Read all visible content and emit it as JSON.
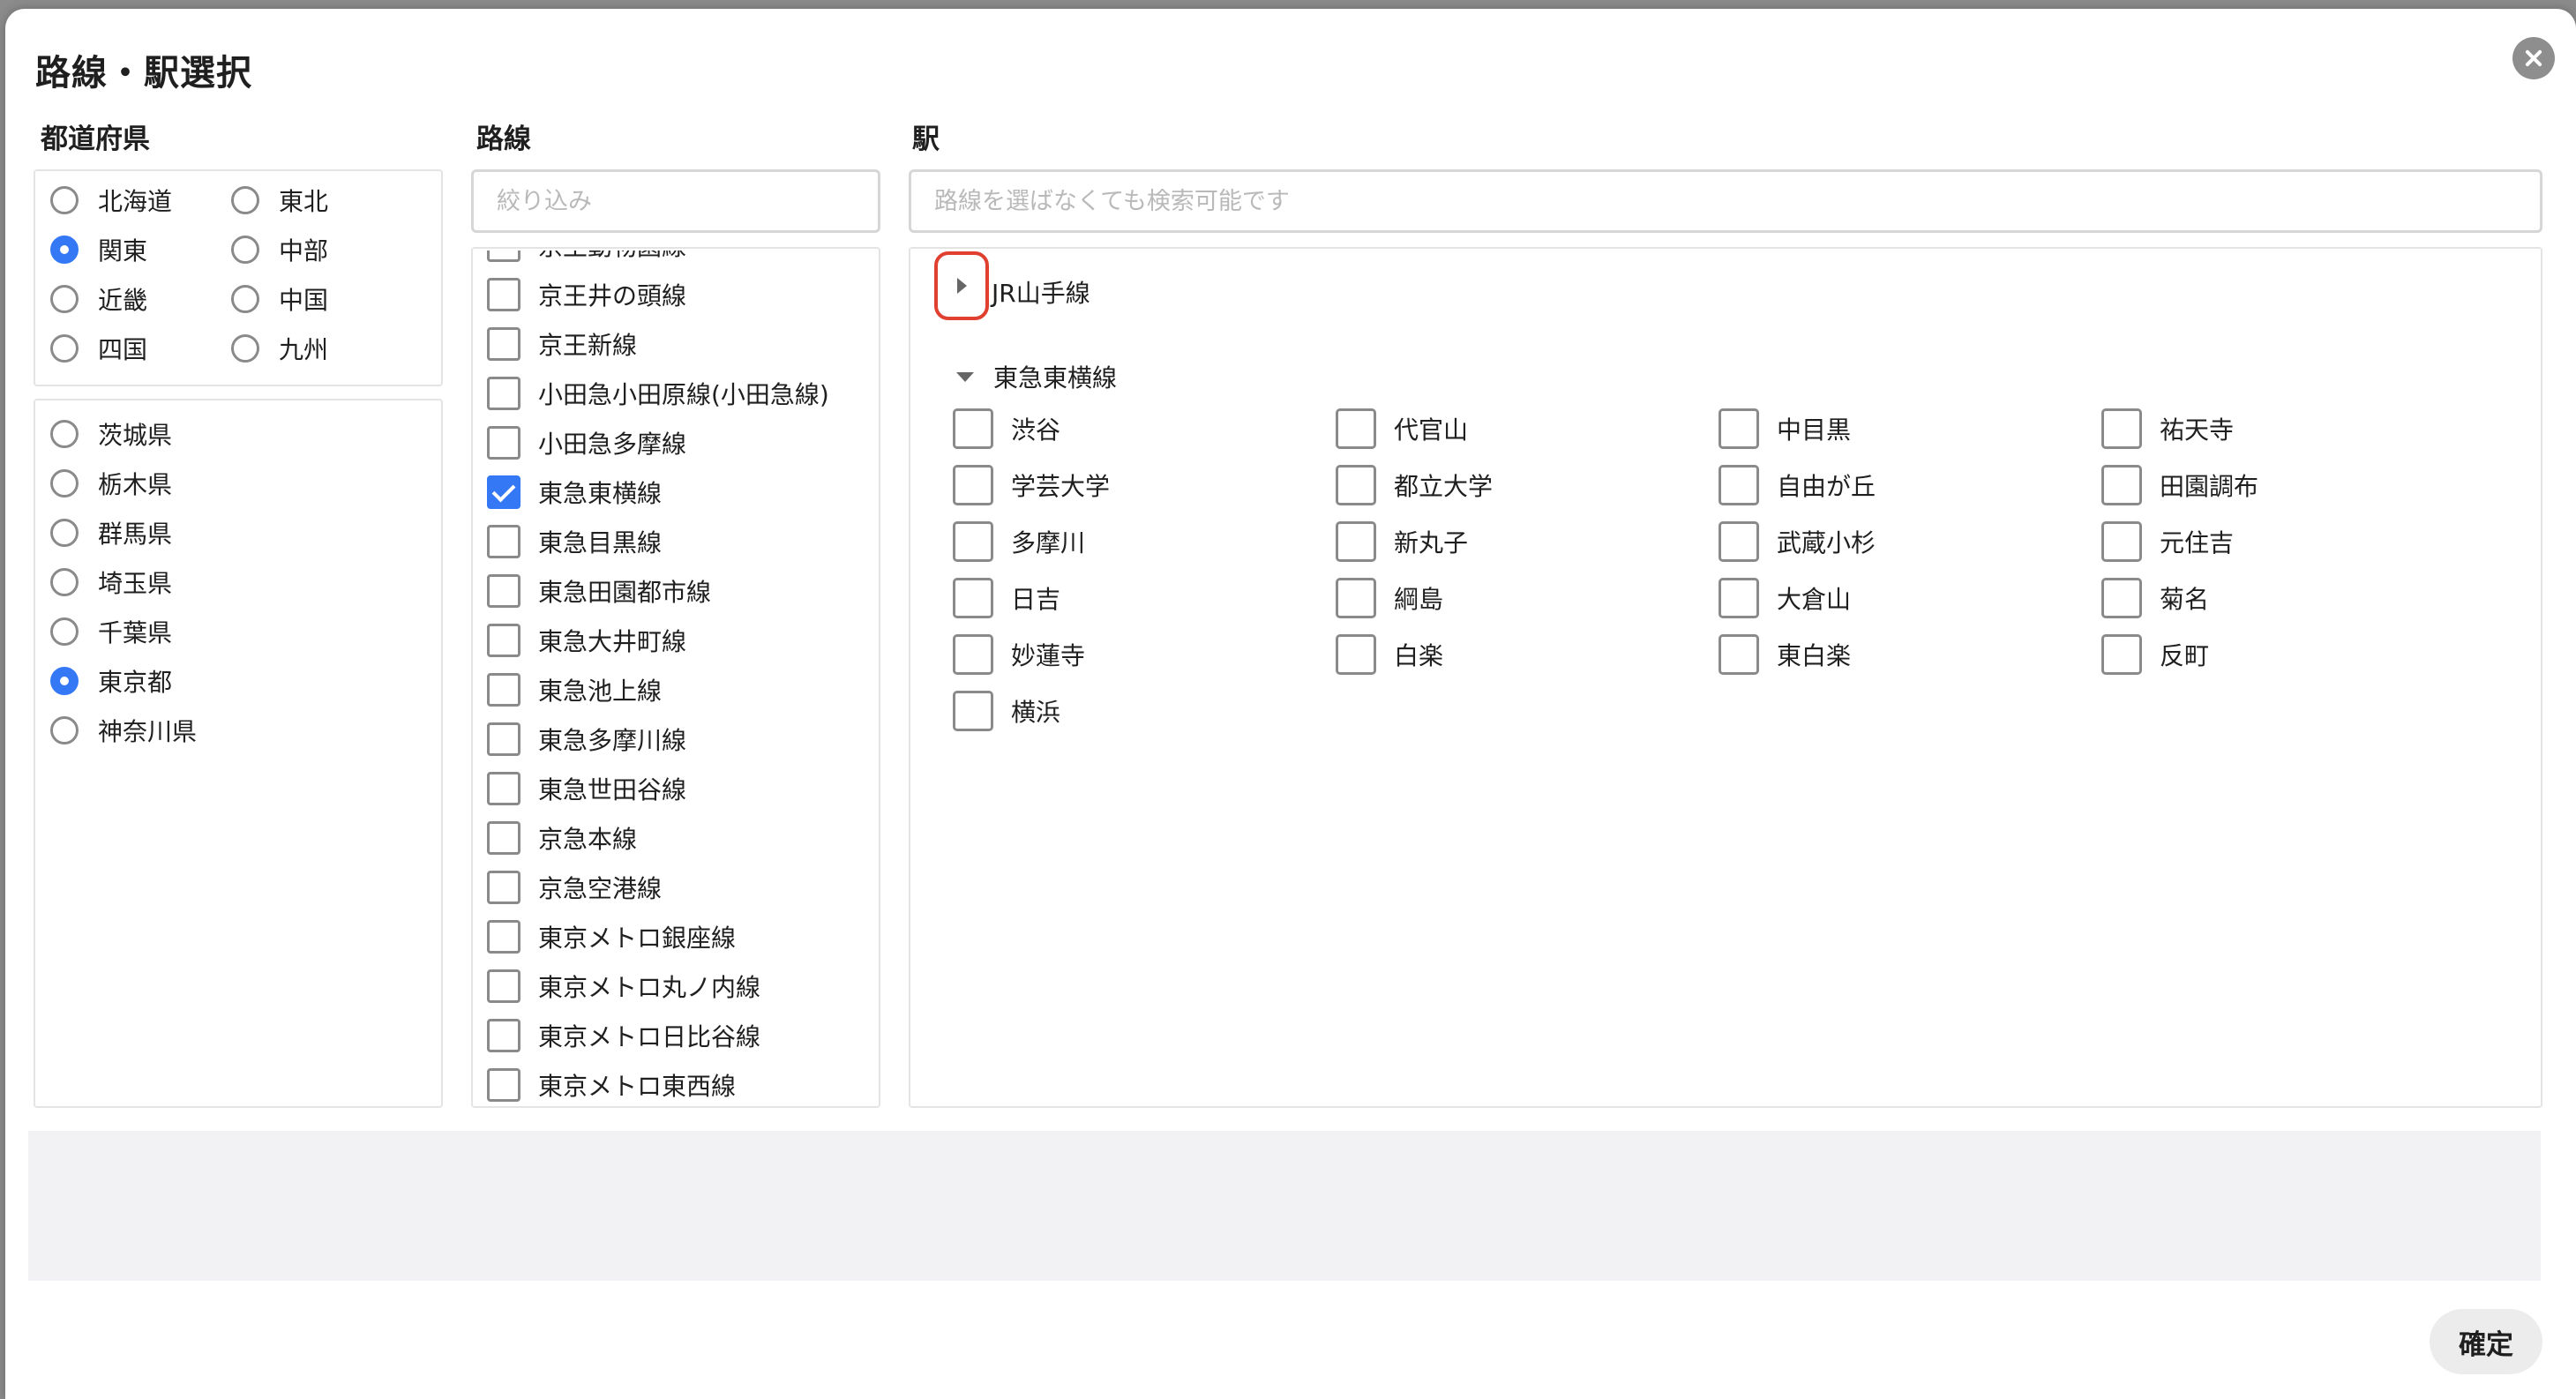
{
  "title": "路線・駅選択",
  "headings": {
    "prefecture": "都道府県",
    "line": "路線",
    "station": "駅"
  },
  "line_filter": {
    "value": "",
    "placeholder": "絞り込み"
  },
  "station_search": {
    "value": "",
    "placeholder": "路線を選ばなくても検索可能です"
  },
  "regions": [
    {
      "label": "北海道",
      "selected": false
    },
    {
      "label": "東北",
      "selected": false
    },
    {
      "label": "関東",
      "selected": true
    },
    {
      "label": "中部",
      "selected": false
    },
    {
      "label": "近畿",
      "selected": false
    },
    {
      "label": "中国",
      "selected": false
    },
    {
      "label": "四国",
      "selected": false
    },
    {
      "label": "九州",
      "selected": false
    }
  ],
  "prefectures": [
    {
      "label": "茨城県",
      "selected": false
    },
    {
      "label": "栃木県",
      "selected": false
    },
    {
      "label": "群馬県",
      "selected": false
    },
    {
      "label": "埼玉県",
      "selected": false
    },
    {
      "label": "千葉県",
      "selected": false
    },
    {
      "label": "東京都",
      "selected": true
    },
    {
      "label": "神奈川県",
      "selected": false
    }
  ],
  "lines": [
    {
      "label": "京王動物園線",
      "checked": false
    },
    {
      "label": "京王井の頭線",
      "checked": false
    },
    {
      "label": "京王新線",
      "checked": false
    },
    {
      "label": "小田急小田原線(小田急線)",
      "checked": false
    },
    {
      "label": "小田急多摩線",
      "checked": false
    },
    {
      "label": "東急東横線",
      "checked": true
    },
    {
      "label": "東急目黒線",
      "checked": false
    },
    {
      "label": "東急田園都市線",
      "checked": false
    },
    {
      "label": "東急大井町線",
      "checked": false
    },
    {
      "label": "東急池上線",
      "checked": false
    },
    {
      "label": "東急多摩川線",
      "checked": false
    },
    {
      "label": "東急世田谷線",
      "checked": false
    },
    {
      "label": "京急本線",
      "checked": false
    },
    {
      "label": "京急空港線",
      "checked": false
    },
    {
      "label": "東京メトロ銀座線",
      "checked": false
    },
    {
      "label": "東京メトロ丸ノ内線",
      "checked": false
    },
    {
      "label": "東京メトロ日比谷線",
      "checked": false
    },
    {
      "label": "東京メトロ東西線",
      "checked": false
    }
  ],
  "station_groups": [
    {
      "label": "JR山手線",
      "expanded": false,
      "focused": true
    },
    {
      "label": "東急東横線",
      "expanded": true,
      "focused": false
    }
  ],
  "stations": [
    "渋谷",
    "代官山",
    "中目黒",
    "祐天寺",
    "学芸大学",
    "都立大学",
    "自由が丘",
    "田園調布",
    "多摩川",
    "新丸子",
    "武蔵小杉",
    "元住吉",
    "日吉",
    "綱島",
    "大倉山",
    "菊名",
    "妙蓮寺",
    "白楽",
    "東白楽",
    "反町",
    "横浜"
  ],
  "confirm_label": "確定",
  "colors": {
    "accent": "#3478f6",
    "focus": "#e0402f"
  }
}
